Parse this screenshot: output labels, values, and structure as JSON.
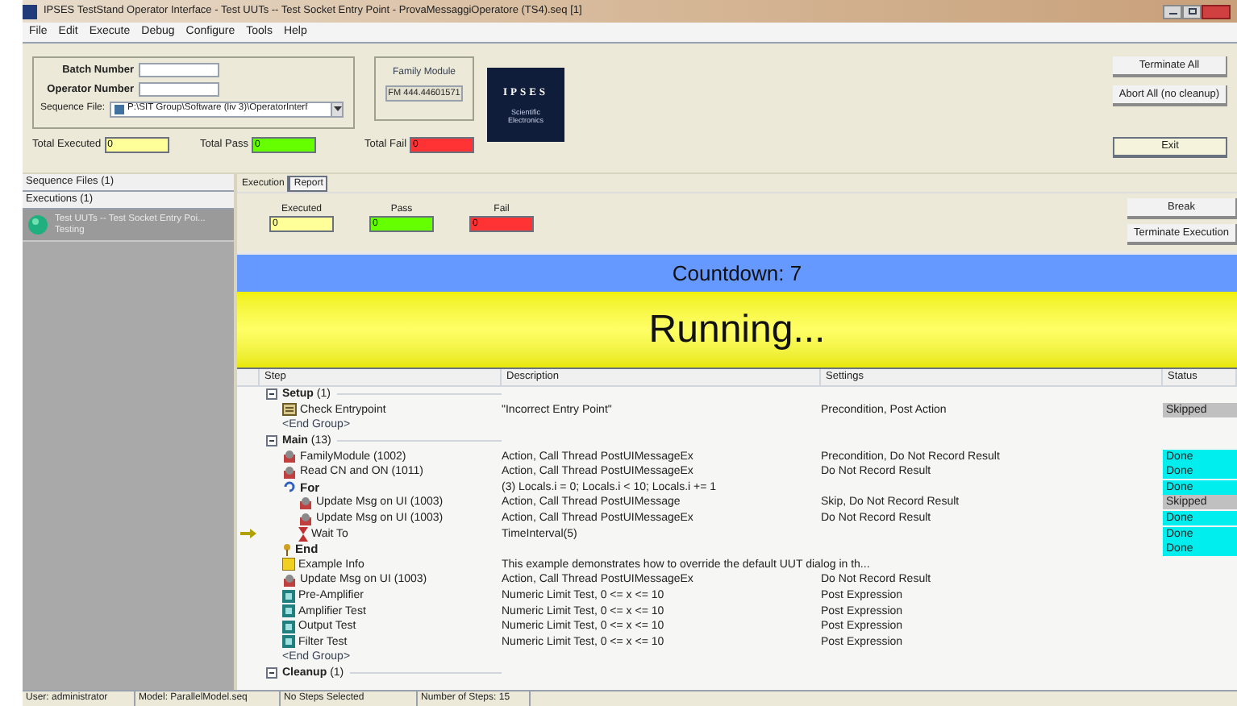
{
  "window": {
    "title": "IPSES TestStand Operator Interface - Test UUTs -- Test Socket Entry Point - ProvaMessaggiOperatore (TS4).seq [1]"
  },
  "menu": [
    "File",
    "Edit",
    "Execute",
    "Debug",
    "Configure",
    "Tools",
    "Help"
  ],
  "form": {
    "batch_label": "Batch Number",
    "operator_label": "Operator Number",
    "sequence_label": "Sequence File:",
    "sequence_value": "P:\\SIT Group\\Software (liv 3)\\OperatorInterf"
  },
  "family_module": {
    "label": "Family Module",
    "value": "FM 444.44601571"
  },
  "logo": {
    "name": "IPSES",
    "tagline": "Scientific Electronics"
  },
  "top_buttons": [
    "Terminate All",
    "Abort All (no cleanup)"
  ],
  "exit_button": "Exit",
  "totals": [
    {
      "label": "Total Executed",
      "value": "0",
      "color": "#ffff99"
    },
    {
      "label": "Total Pass",
      "value": "0",
      "color": "#66ff00"
    },
    {
      "label": "Total Fail",
      "value": "0",
      "color": "#ff3333"
    }
  ],
  "sidebar": {
    "sequence_files": "Sequence Files (1)",
    "executions": "Executions (1)",
    "items": [
      {
        "title": "Test UUTs -- Test Socket Entry Poi...",
        "state": "Testing",
        "selected": true
      }
    ]
  },
  "tabs": [
    {
      "label": "Execution",
      "selected": true
    },
    {
      "label": "Report",
      "selected": false
    }
  ],
  "counters": [
    {
      "label": "Executed",
      "value": "0",
      "color": "#ffff99"
    },
    {
      "label": "Pass",
      "value": "0",
      "color": "#66ff00"
    },
    {
      "label": "Fail",
      "value": "0",
      "color": "#ff3333"
    }
  ],
  "execution_buttons": [
    "Break",
    "Terminate Execution"
  ],
  "countdown": "Countdown: 7",
  "banner": "Running...",
  "table": {
    "columns": [
      "Step",
      "Description",
      "Settings",
      "Status"
    ],
    "steps": [
      {
        "kind": "group",
        "label": "**Setup** (1)",
        "expanded": true,
        "children": [
          {
            "kind": "check",
            "label": "Check Entrypoint",
            "description": "\"Incorrect Entry Point\"",
            "settings": "Precondition, Post Action",
            "status": {
              "text": "Skipped",
              "color": "#c0c0c0"
            }
          },
          {
            "kind": "end_group",
            "label": "<End Group>"
          }
        ]
      },
      {
        "kind": "group",
        "label": "**Main** (13)",
        "expanded": true,
        "children": [
          {
            "kind": "action",
            "label": "FamilyModule (1002)",
            "description": "Action,  Call Thread PostUIMessageEx",
            "settings": "Precondition, Do Not Record Result",
            "status": {
              "text": "Done",
              "color": "#00eeee"
            }
          },
          {
            "kind": "action",
            "label": "Read CN and ON (1011)",
            "description": "Action,  Call Thread PostUIMessageEx",
            "settings": "Do Not Record Result",
            "status": {
              "text": "Done",
              "color": "#00eeee"
            }
          },
          {
            "kind": "loop",
            "label": "For",
            "description": "(3) Locals.i = 0; Locals.i < 10; Locals.i += 1",
            "status": {
              "text": "Done",
              "color": "#00eeee"
            },
            "children": [
              {
                "kind": "action",
                "label": "Update Msg on UI (1003)",
                "description": "Action,  Call Thread PostUIMessage",
                "settings": "Skip, Do Not Record Result",
                "status": {
                  "text": "Skipped",
                  "color": "#c0c0c0"
                }
              },
              {
                "kind": "action",
                "label": "Update Msg on UI (1003)",
                "description": "Action,  Call Thread PostUIMessageEx",
                "settings": "Do Not Record Result",
                "status": {
                  "text": "Done",
                  "color": "#00eeee"
                }
              },
              {
                "kind": "wait",
                "label": "Wait To",
                "description": "TimeInterval(5)",
                "status": {
                  "text": "Done",
                  "color": "#00eeee"
                },
                "current": true
              }
            ]
          },
          {
            "kind": "end",
            "label": "End",
            "status": {
              "text": "Done",
              "color": "#00eeee"
            }
          },
          {
            "kind": "label",
            "label": "Example Info",
            "description": "This example demonstrates how to override the default UUT dialog in th..."
          },
          {
            "kind": "action",
            "label": "Update Msg on UI (1003)",
            "description": "Action,  Call Thread PostUIMessageEx",
            "settings": "Do Not Record Result"
          },
          {
            "kind": "test",
            "label": "Pre-Amplifier",
            "description": "Numeric Limit Test,  0 <= x <= 10",
            "settings": "Post Expression"
          },
          {
            "kind": "test",
            "label": "Amplifier Test",
            "description": "Numeric Limit Test,  0 <= x <= 10",
            "settings": "Post Expression"
          },
          {
            "kind": "test",
            "label": "Output Test",
            "description": "Numeric Limit Test,  0 <= x <= 10",
            "settings": "Post Expression"
          },
          {
            "kind": "test",
            "label": "Filter Test",
            "description": "Numeric Limit Test,  0 <= x <= 10",
            "settings": "Post Expression"
          },
          {
            "kind": "end_group",
            "label": "<End Group>"
          }
        ]
      },
      {
        "kind": "group",
        "label": "**Cleanup** (1)",
        "expanded": true
      }
    ]
  },
  "status_bar": [
    "User: administrator",
    "Model: ParallelModel.seq",
    "No Steps Selected",
    "Number of Steps: 15"
  ]
}
